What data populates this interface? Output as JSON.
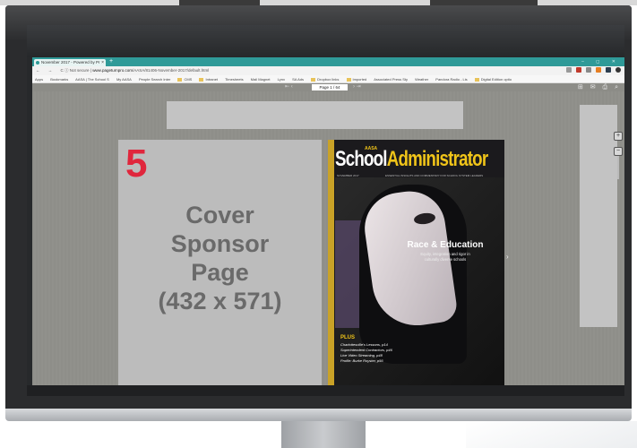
{
  "browser": {
    "tab_title": "November 2017 - Powered by Pr",
    "tab_close": "×",
    "new_tab": "+",
    "window_controls": "– ◻ ✕",
    "nav_buttons": "← → C",
    "security_label": "ⓘ Not secure",
    "url_domain": "www.pageturnpro.com",
    "url_path": "/AASA/81406-November-2017/default.html",
    "bookmarks": [
      "Apps",
      "Bookmarks",
      "AASA | The School S",
      "My AASA",
      "People Search Inter",
      "CMS",
      "Intranet",
      "Timesheets",
      "Mail Magnet",
      "Lynx",
      "SA Ads",
      "Dropbox links",
      "Imported",
      "Associated Press Sty",
      "Weather",
      "Pandora Radio - Lis",
      "Digital Edition optio"
    ]
  },
  "viewer": {
    "page_indicator": "Page 1 / 64",
    "prev_icons": "⇤ ‹",
    "next_icons": "› ⇥",
    "toolbar_icons": "⊞ ✉ ⎙ ⌕",
    "zoom_in": "+",
    "zoom_out": "−",
    "next_page_arrow": "›"
  },
  "sponsor_page": {
    "number": "5",
    "lines": [
      "Cover",
      "Sponsor",
      "Page",
      "(432 x 571)"
    ]
  },
  "cover": {
    "publisher": "AASA",
    "masthead_part1": "School",
    "masthead_part2": "Administrator",
    "date": "NOVEMBER 2017",
    "tagline": "ESSENTIAL INSIGHTS AND COMMENTARY FOR SCHOOL SYSTEM LEADERS",
    "headline": "Race & Education",
    "subhead": [
      "Equity, integration and rigor in",
      "culturally diverse schools"
    ],
    "plus_label": "PLUS",
    "plus_items": [
      "Charlottesville's Lessons, p14",
      "Superintendent Contractors, p46",
      "Live Video Streaming, p48",
      "Profile: Burke Royster, p56"
    ]
  },
  "colors": {
    "tab_bar": "#2f9a98",
    "sponsor_number": "#e0263c",
    "masthead_accent": "#f0c419"
  }
}
